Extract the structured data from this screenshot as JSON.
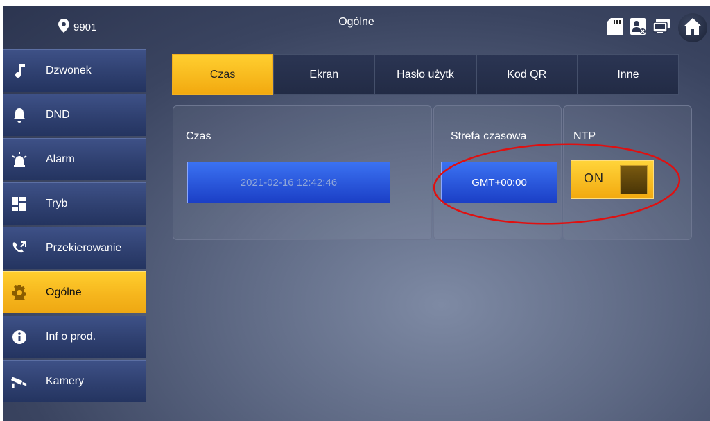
{
  "header": {
    "room_number": "9901",
    "title": "Ogólne",
    "status_icons": [
      "sd-card-icon",
      "contact-icon",
      "monitor-icon",
      "home-icon"
    ]
  },
  "sidebar": {
    "items": [
      {
        "label": "Dzwonek",
        "icon": "music-note-icon",
        "active": false
      },
      {
        "label": "DND",
        "icon": "bell-icon",
        "active": false
      },
      {
        "label": "Alarm",
        "icon": "alarm-siren-icon",
        "active": false
      },
      {
        "label": "Tryb",
        "icon": "grid-icon",
        "active": false
      },
      {
        "label": "Przekierowanie",
        "icon": "phone-forward-icon",
        "active": false
      },
      {
        "label": "Ogólne",
        "icon": "gear-icon",
        "active": true
      },
      {
        "label": "Inf o prod.",
        "icon": "info-icon",
        "active": false
      },
      {
        "label": "Kamery",
        "icon": "camera-icon",
        "active": false
      }
    ]
  },
  "tabs": [
    {
      "label": "Czas",
      "active": true
    },
    {
      "label": "Ekran",
      "active": false
    },
    {
      "label": "Hasło użytk",
      "active": false
    },
    {
      "label": "Kod QR",
      "active": false
    },
    {
      "label": "Inne",
      "active": false
    }
  ],
  "main": {
    "time": {
      "label": "Czas",
      "value": "2021-02-16 12:42:46"
    },
    "timezone": {
      "label": "Strefa czasowa",
      "value": "GMT+00:00"
    },
    "ntp": {
      "label": "NTP",
      "toggle_text": "ON",
      "state": true
    }
  },
  "colors": {
    "accent_yellow": "#f6b61d",
    "field_blue": "#2a56dc",
    "annotation_red": "#e01010"
  }
}
